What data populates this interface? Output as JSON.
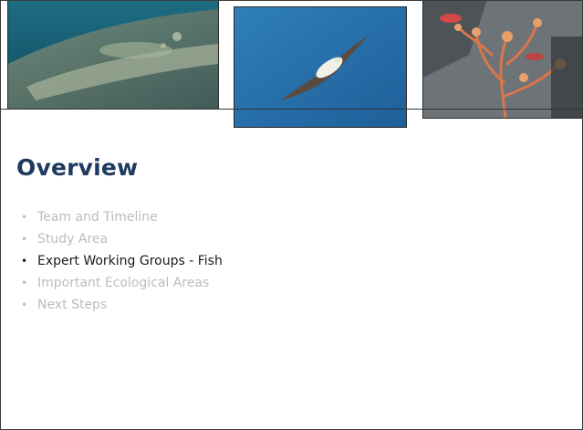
{
  "slide": {
    "title": "Overview",
    "images": [
      {
        "icon": "whale-photo"
      },
      {
        "icon": "seabird-photo"
      },
      {
        "icon": "coral-fish-photo"
      }
    ],
    "bullets": [
      {
        "label": "Team and Timeline",
        "active": false
      },
      {
        "label": "Study Area",
        "active": false
      },
      {
        "label": "Expert Working Groups - Fish",
        "active": true
      },
      {
        "label": "Important Ecological Areas",
        "active": false
      },
      {
        "label": "Next Steps",
        "active": false
      }
    ],
    "bullet_symbol": "•"
  },
  "colors": {
    "title": "#1f3a5f",
    "active_text": "#1a1a1a",
    "inactive_text": "#bdbdbd",
    "rule": "#333333"
  }
}
